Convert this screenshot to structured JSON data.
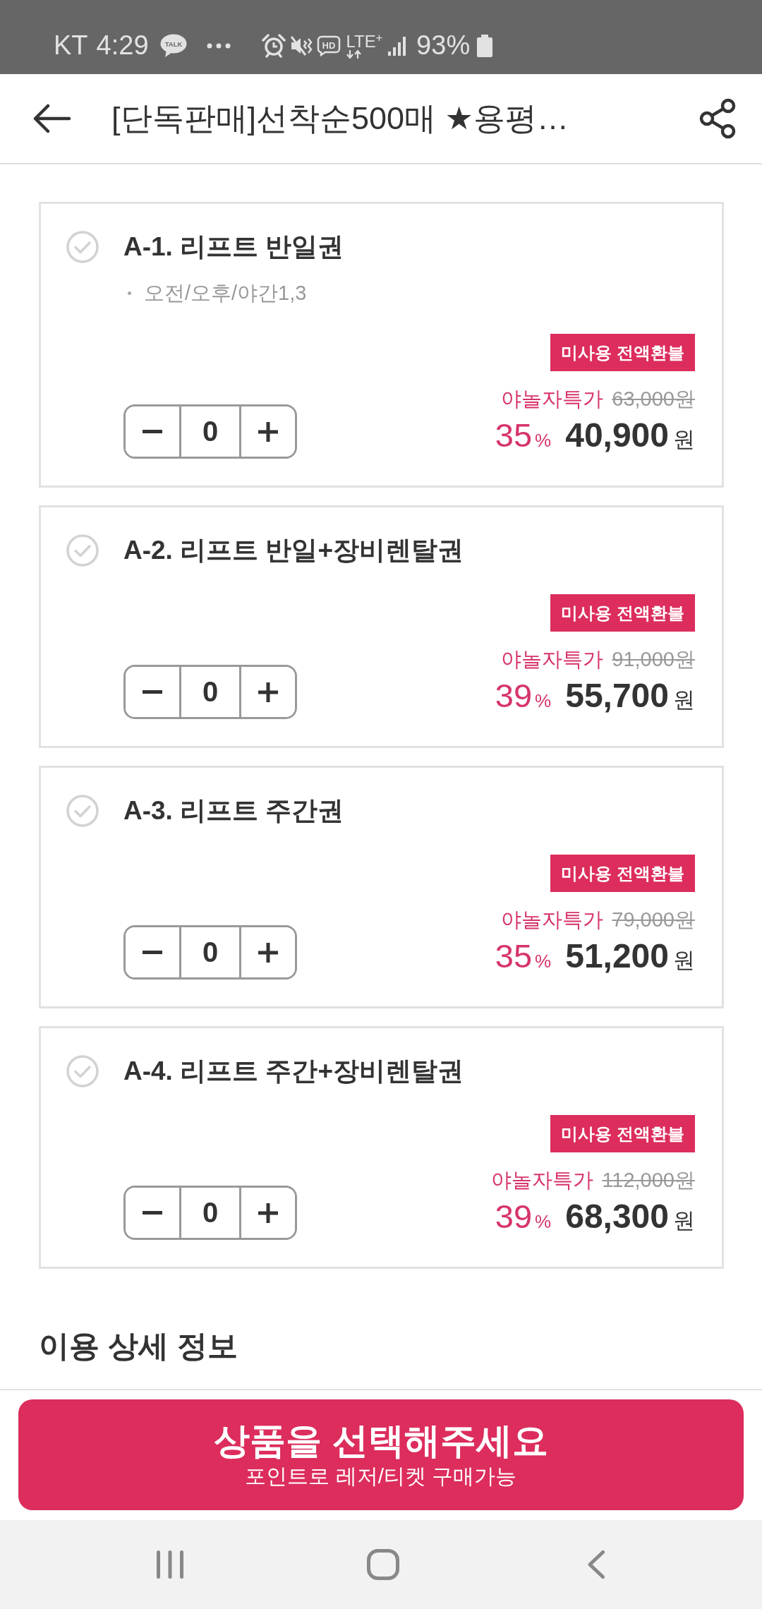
{
  "status_bar": {
    "carrier": "KT",
    "time": "4:29",
    "chat_icon_text": "TALK",
    "hd_icon_text": "HD",
    "network": "LTE$^{+}$",
    "battery": "93%"
  },
  "header": {
    "title": "[단독판매]선착순500매 ★용평…"
  },
  "options": [
    {
      "selected": false,
      "name": "A-1. 리프트 반일권",
      "notes": [
        "오전/오후/야간1,3"
      ],
      "badge": "미사용 전액환불",
      "price_label": "야놀자특가",
      "original_price": "63,000원",
      "discount_rate": "35",
      "discount_unit": "%",
      "price": "40,900",
      "currency": "원",
      "quantity": "0"
    },
    {
      "selected": false,
      "name": "A-2. 리프트 반일+장비렌탈권",
      "badge": "미사용 전액환불",
      "price_label": "야놀자특가",
      "original_price": "91,000원",
      "discount_rate": "39",
      "discount_unit": "%",
      "price": "55,700",
      "currency": "원",
      "quantity": "0"
    },
    {
      "selected": false,
      "name": "A-3. 리프트 주간권",
      "badge": "미사용 전액환불",
      "price_label": "야놀자특가",
      "original_price": "79,000원",
      "discount_rate": "35",
      "discount_unit": "%",
      "price": "51,200",
      "currency": "원",
      "quantity": "0"
    },
    {
      "selected": false,
      "name": "A-4. 리프트 주간+장비렌탈권",
      "badge": "미사용 전액환불",
      "price_label": "야놀자특가",
      "original_price": "112,000원",
      "discount_rate": "39",
      "discount_unit": "%",
      "price": "68,300",
      "currency": "원",
      "quantity": "0"
    }
  ],
  "section_title": "이용 상세 정보",
  "cta_button": {
    "label": "상품을 선택해주세요",
    "sublabel": "포인트로 레저/티켓 구매가능"
  }
}
